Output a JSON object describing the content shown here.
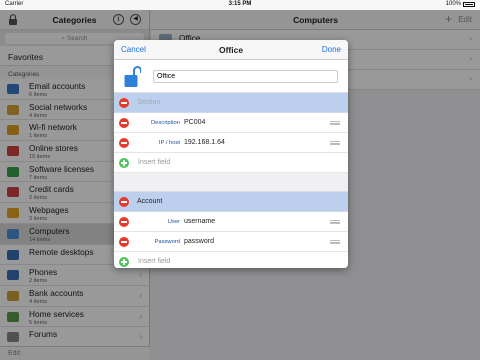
{
  "status": {
    "carrier": "Carrier",
    "time": "3:15 PM",
    "battery": "100%"
  },
  "sidebar": {
    "title": "Categories",
    "search_placeholder": "Search",
    "favorites": "Favorites",
    "section": "Categories",
    "edit": "Edit",
    "items": [
      {
        "name": "Email accounts",
        "count": "6 items",
        "color": "#3a78c9"
      },
      {
        "name": "Social networks",
        "count": "4 items",
        "color": "#d9a43a"
      },
      {
        "name": "Wi-fi network",
        "count": "1 items",
        "color": "#e0a020"
      },
      {
        "name": "Online stores",
        "count": "15 items",
        "color": "#d04444"
      },
      {
        "name": "Software licenses",
        "count": "7 items",
        "color": "#3aa04a"
      },
      {
        "name": "Credit cards",
        "count": "2 items",
        "color": "#d04444"
      },
      {
        "name": "Webpages",
        "count": "3 items",
        "color": "#e3a521"
      },
      {
        "name": "Computers",
        "count": "14 items",
        "color": "#4a8fd8"
      },
      {
        "name": "Remote desktops",
        "count": "",
        "color": "#3a6fb8"
      },
      {
        "name": "Phones",
        "count": "2 items",
        "color": "#3a6fb8"
      },
      {
        "name": "Bank accounts",
        "count": "4 items",
        "color": "#c8a03a"
      },
      {
        "name": "Home services",
        "count": "5 items",
        "color": "#5a9a4a"
      },
      {
        "name": "Forums",
        "count": "",
        "color": "#888888"
      }
    ]
  },
  "main": {
    "title": "Computers",
    "edit": "Edit",
    "rows": [
      {
        "name": "Office"
      }
    ]
  },
  "modal": {
    "cancel": "Cancel",
    "title": "Office",
    "done": "Done",
    "entry_title": "Office",
    "section1": {
      "placeholder": "Section"
    },
    "fields1": [
      {
        "label": "Description",
        "value": "PC004"
      },
      {
        "label": "IP / host",
        "value": "192.168.1.64"
      }
    ],
    "insert_label": "Insert field",
    "section2": {
      "label": "Account"
    },
    "fields2": [
      {
        "label": "User",
        "value": "username"
      },
      {
        "label": "Password",
        "value": "password"
      }
    ]
  }
}
